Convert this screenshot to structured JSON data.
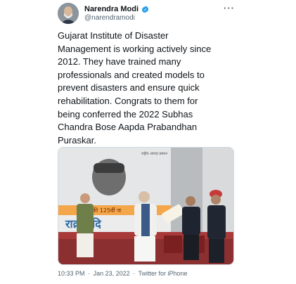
{
  "author": {
    "display_name": "Narendra Modi",
    "handle": "@narendramodi",
    "verified_icon": "verified-badge-icon"
  },
  "menu": {
    "more_label": "···"
  },
  "tweet": {
    "text": "Gujarat Institute of Disaster\nManagement is working actively since\n2012. They have trained many\nprofessionals and created models to\nprevent disasters and ensure quick\nrehabilitation. Congrats to them for\nbeing conferred the 2022 Subhas\nChandra Bose Aapda Prabandhan\nPuraskar.",
    "media": {
      "banner_text": "की 125वीं ज",
      "banner_text2": "राक्रम दि",
      "logo_text": "राष्ट्रीय आपदा प्रबंधन"
    }
  },
  "meta": {
    "time": "10:33 PM",
    "sep": "·",
    "date": "Jan 23, 2022",
    "source": "Twitter for iPhone"
  },
  "colors": {
    "accent": "#1d9bf0",
    "secondary_text": "#536471"
  }
}
